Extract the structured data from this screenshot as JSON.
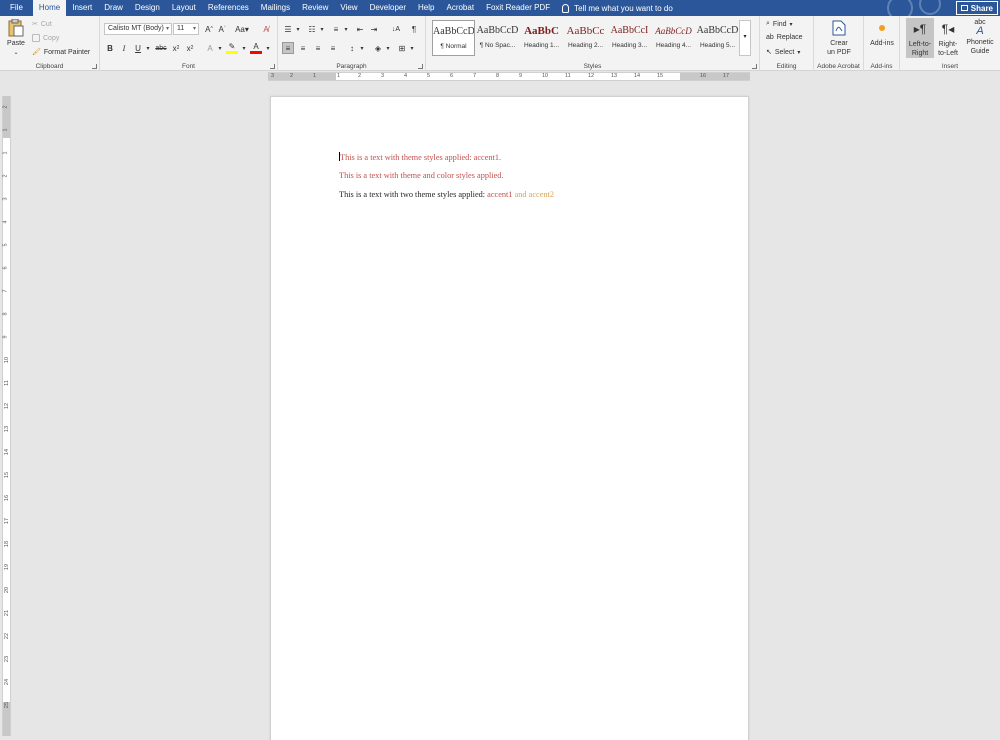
{
  "ribbon_tabs": [
    {
      "label": "File",
      "active": false
    },
    {
      "label": "Home",
      "active": true
    },
    {
      "label": "Insert",
      "active": false
    },
    {
      "label": "Draw",
      "active": false
    },
    {
      "label": "Design",
      "active": false
    },
    {
      "label": "Layout",
      "active": false
    },
    {
      "label": "References",
      "active": false
    },
    {
      "label": "Mailings",
      "active": false
    },
    {
      "label": "Review",
      "active": false
    },
    {
      "label": "View",
      "active": false
    },
    {
      "label": "Developer",
      "active": false
    },
    {
      "label": "Help",
      "active": false
    },
    {
      "label": "Acrobat",
      "active": false
    },
    {
      "label": "Foxit Reader PDF",
      "active": false
    }
  ],
  "tell_me": "Tell me what you want to do",
  "share_label": "Share",
  "clipboard": {
    "paste": "Paste",
    "cut": "Cut",
    "copy": "Copy",
    "format_painter": "Format Painter",
    "label": "Clipboard"
  },
  "font": {
    "font_name": "Calisto MT (Body)",
    "font_size": "11",
    "change_case": "Aa",
    "label": "Font"
  },
  "paragraph": {
    "label": "Paragraph"
  },
  "styles": {
    "items": [
      {
        "preview": "AaBbCcD",
        "name": "¶ Normal",
        "selected": true
      },
      {
        "preview": "AaBbCcD",
        "name": "¶ No Spac...",
        "selected": false
      },
      {
        "preview": "AaBbC",
        "name": "Heading 1...",
        "selected": false
      },
      {
        "preview": "AaBbCc",
        "name": "Heading 2...",
        "selected": false
      },
      {
        "preview": "AaBbCcI",
        "name": "Heading 3...",
        "selected": false
      },
      {
        "preview": "AaBbCcD",
        "name": "Heading 4...",
        "selected": false
      },
      {
        "preview": "AaBbCcD",
        "name": "Heading 5...",
        "selected": false
      }
    ],
    "label": "Styles"
  },
  "editing": {
    "find": "Find",
    "replace": "Replace",
    "select": "Select",
    "label": "Editing"
  },
  "adobe": {
    "line1": "Crear",
    "line2": "un PDF",
    "label": "Adobe Acrobat"
  },
  "addins": {
    "button": "Add-ins",
    "label": "Add-ins"
  },
  "insert_group": {
    "ltr_line1": "Left-to-",
    "ltr_line2": "Right",
    "rtl_line1": "Right-",
    "rtl_line2": "to-Left",
    "phon_line1": "Phonetic",
    "phon_line2": "Guide",
    "label": "Insert"
  },
  "ruler": {
    "h_numbers": [
      "3",
      "2",
      "1",
      "1",
      "2",
      "3",
      "4",
      "5",
      "6",
      "7",
      "8",
      "9",
      "10",
      "11",
      "12",
      "13",
      "14",
      "15",
      "16",
      "17"
    ],
    "v_numbers": [
      "2",
      "1",
      "1",
      "2",
      "3",
      "4",
      "5",
      "6",
      "7",
      "8",
      "9",
      "10",
      "11",
      "12",
      "13",
      "14",
      "15",
      "16",
      "17",
      "18",
      "19",
      "20",
      "21",
      "22",
      "23",
      "24",
      "25"
    ]
  },
  "document": {
    "line1": "This is a text with theme styles applied: accent1.",
    "line2": "This is a text with theme and color styles applied.",
    "line3_prefix": "This is a text with two theme styles applied: ",
    "line3_accent1": "accent1",
    "line3_accent2": " and accent2"
  },
  "colors": {
    "brand": "#2b579a",
    "accent1": "#c0504d",
    "accent2": "#d4a45a"
  }
}
